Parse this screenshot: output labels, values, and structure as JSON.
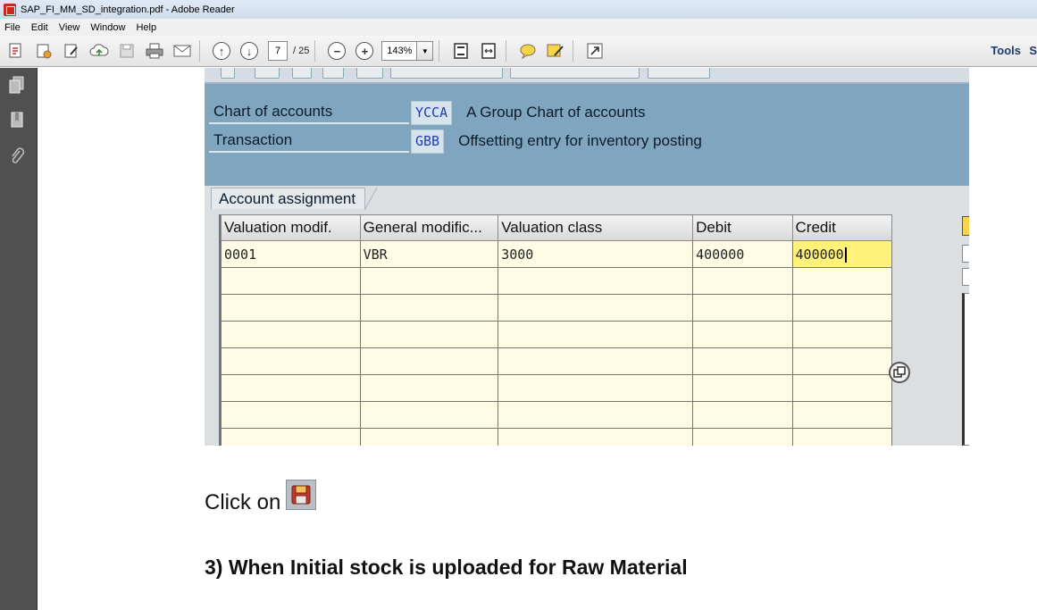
{
  "window": {
    "title": "SAP_FI_MM_SD_integration.pdf - Adobe Reader"
  },
  "menu": {
    "items": [
      "File",
      "Edit",
      "View",
      "Window",
      "Help"
    ]
  },
  "toolbar": {
    "page_current": "7",
    "page_total": "/ 25",
    "zoom": "143%",
    "tools_label": "Tools",
    "edge_label": "S"
  },
  "sap": {
    "chart_of_accounts": {
      "label": "Chart of accounts",
      "value": "YCCA",
      "description": "A Group Chart of accounts"
    },
    "transaction": {
      "label": "Transaction",
      "value": "GBB",
      "description": "Offsetting entry for inventory posting"
    },
    "tab_label": "Account assignment",
    "grid": {
      "columns": [
        "Valuation modif.",
        "General modific...",
        "Valuation class",
        "Debit",
        "Credit"
      ],
      "rows": [
        [
          "0001",
          "VBR",
          "3000",
          "400000",
          "400000"
        ]
      ],
      "empty_rows": 7
    }
  },
  "document": {
    "click_on": "Click on",
    "heading": "3) When Initial stock is uploaded for Raw Material"
  },
  "colors": {
    "sap_header": "#80a6bf",
    "grid_cell": "#fffbe4",
    "active_cell": "#fff17a",
    "value_text": "#1d3fb0"
  }
}
